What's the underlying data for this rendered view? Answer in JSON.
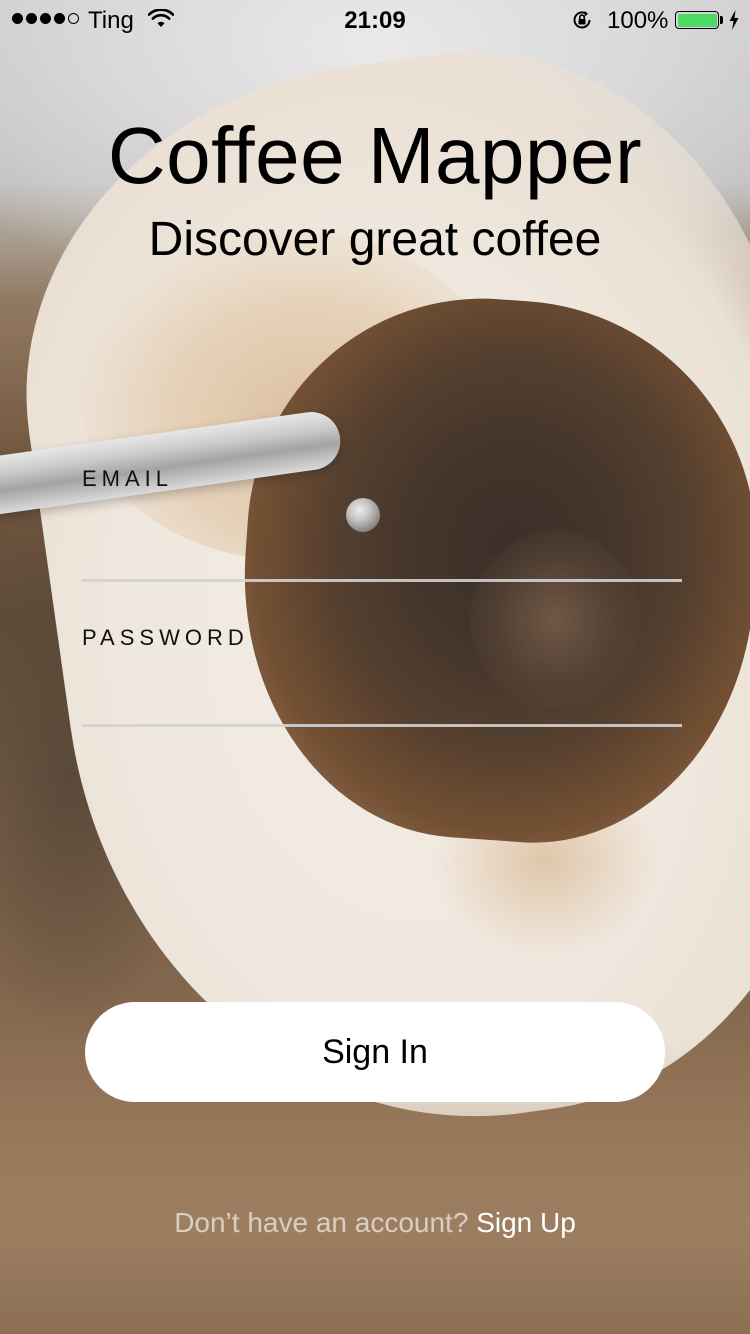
{
  "status_bar": {
    "carrier": "Ting",
    "time": "21:09",
    "battery_percent": "100%",
    "battery_level": 1.0,
    "signal_bars_filled": 4,
    "signal_bars_total": 5
  },
  "app": {
    "title": "Coffee Mapper",
    "subtitle": "Discover great coffee"
  },
  "form": {
    "email_label": "EMAIL",
    "email_value": "",
    "password_label": "PASSWORD",
    "password_value": "",
    "signin_label": "Sign In"
  },
  "footer": {
    "prompt": "Don’t have an account?",
    "signup_label": "Sign Up"
  },
  "colors": {
    "battery_fill": "#4cd964",
    "button_background": "#ffffff",
    "input_underline": "#d2d2d2"
  }
}
